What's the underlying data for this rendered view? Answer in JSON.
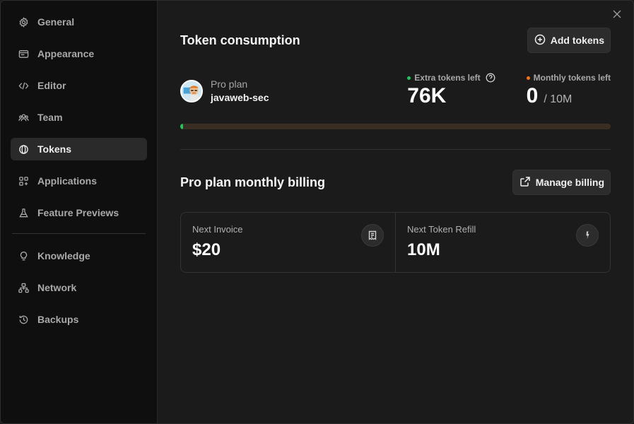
{
  "sidebar": {
    "items": [
      {
        "label": "General",
        "icon": "gear-icon",
        "active": false
      },
      {
        "label": "Appearance",
        "icon": "appearance-icon",
        "active": false
      },
      {
        "label": "Editor",
        "icon": "code-icon",
        "active": false
      },
      {
        "label": "Team",
        "icon": "team-icon",
        "active": false
      },
      {
        "label": "Tokens",
        "icon": "token-icon",
        "active": true
      },
      {
        "label": "Applications",
        "icon": "applications-icon",
        "active": false
      },
      {
        "label": "Feature Previews",
        "icon": "flask-icon",
        "active": false
      },
      {
        "label": "Knowledge",
        "icon": "lightbulb-icon",
        "active": false
      },
      {
        "label": "Network",
        "icon": "network-icon",
        "active": false
      },
      {
        "label": "Backups",
        "icon": "history-icon",
        "active": false
      }
    ]
  },
  "tokens": {
    "title": "Token consumption",
    "add_button": "Add tokens",
    "plan_name": "Pro plan",
    "username": "javaweb-sec",
    "extra_label": "Extra tokens left",
    "extra_value": "76K",
    "extra_color": "#22c55e",
    "monthly_label": "Monthly tokens left",
    "monthly_value": "0",
    "monthly_suffix": "/ 10M",
    "monthly_color": "#f97316",
    "progress_fraction": 0.006
  },
  "billing": {
    "title": "Pro plan monthly billing",
    "manage_button": "Manage billing",
    "cards": [
      {
        "label": "Next Invoice",
        "value": "$20",
        "icon": "invoice-icon"
      },
      {
        "label": "Next Token Refill",
        "value": "10M",
        "icon": "bolt-token-icon"
      }
    ]
  }
}
